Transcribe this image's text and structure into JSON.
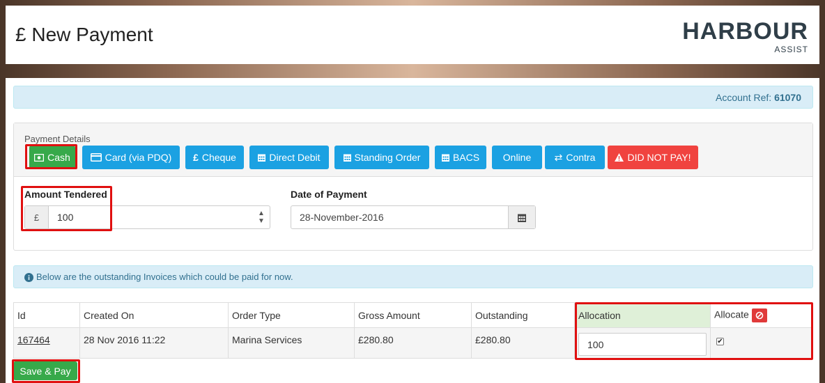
{
  "header": {
    "title": "£ New Payment",
    "logo_main": "HARBOUR",
    "logo_sub": "ASSIST"
  },
  "account": {
    "label": "Account Ref:",
    "ref": "61070"
  },
  "payment_details": {
    "label": "Payment Details",
    "buttons": [
      {
        "label": "Cash",
        "icon": "cash-icon",
        "selected": true
      },
      {
        "label": "Card (via PDQ)",
        "icon": "card-icon"
      },
      {
        "label": "Cheque",
        "icon": "pound-icon"
      },
      {
        "label": "Direct Debit",
        "icon": "calendar-icon"
      },
      {
        "label": "Standing Order",
        "icon": "calendar-icon"
      },
      {
        "label": "BACS",
        "icon": "calendar-icon"
      },
      {
        "label": "Online",
        "icon": ""
      },
      {
        "label": "Contra",
        "icon": "exchange-icon"
      },
      {
        "label": "DID NOT PAY!",
        "icon": "warning-icon"
      }
    ]
  },
  "amount": {
    "label": "Amount Tendered",
    "currency": "£",
    "value": "100"
  },
  "date": {
    "label": "Date of Payment",
    "value": "28-November-2016"
  },
  "info": {
    "text": "Below are the outstanding Invoices which could be paid for now."
  },
  "table": {
    "headers": [
      "Id",
      "Created On",
      "Order Type",
      "Gross Amount",
      "Outstanding",
      "Allocation",
      "Allocate"
    ],
    "rows": [
      {
        "id": "167464",
        "created": "28 Nov 2016 11:22",
        "order_type": "Marina Services",
        "gross": "£280.80",
        "outstanding": "£280.80",
        "allocation": "100",
        "allocate": true
      }
    ]
  },
  "save_button": "Save & Pay",
  "colors": {
    "info": "#31708f",
    "primary": "#1ba1e2",
    "success": "#37a94a",
    "danger": "#f0433f",
    "highlight": "#e01010"
  }
}
